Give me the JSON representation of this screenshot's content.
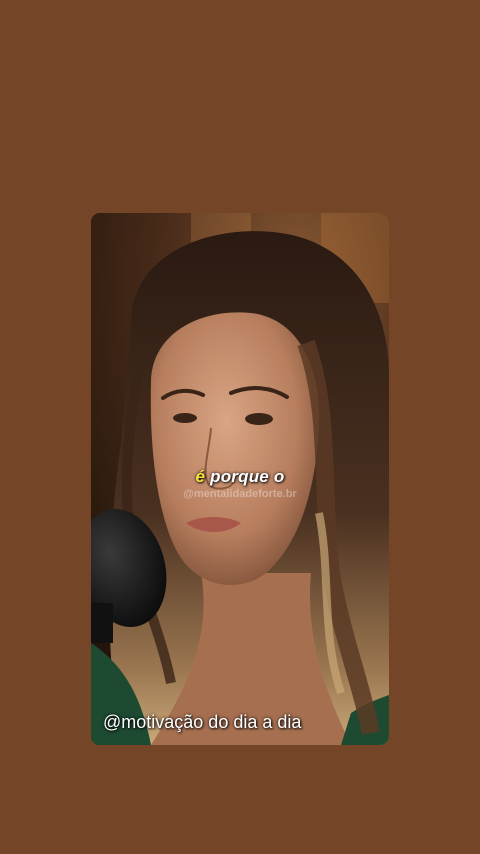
{
  "background_color": "#754527",
  "video": {
    "caption_highlight": "é",
    "caption_rest": " porque o",
    "watermark": "@mentalidadeforte.br",
    "handle": "@motivação do dia a dia"
  },
  "colors": {
    "caption_highlight": "#f4e23c",
    "caption_text": "#ffffff"
  }
}
